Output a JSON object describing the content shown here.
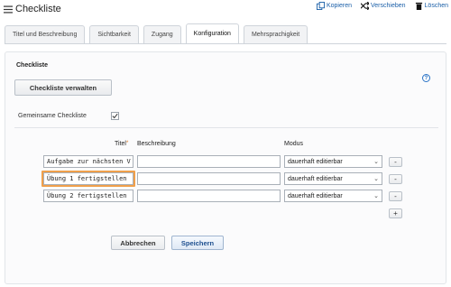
{
  "header": {
    "title": "Checkliste",
    "actions": [
      {
        "label": "Kopieren",
        "icon": "copy-icon"
      },
      {
        "label": "Verschieben",
        "icon": "move-icon"
      },
      {
        "label": "Löschen",
        "icon": "trash-icon"
      }
    ]
  },
  "tabs": [
    {
      "label": "Titel und Beschreibung",
      "active": false
    },
    {
      "label": "Sichtbarkeit",
      "active": false
    },
    {
      "label": "Zugang",
      "active": false
    },
    {
      "label": "Konfiguration",
      "active": true
    },
    {
      "label": "Mehrsprachigkeit",
      "active": false
    }
  ],
  "panel": {
    "section_title": "Checkliste",
    "manage_button": "Checkliste verwalten",
    "help_icon": "help-icon",
    "shared_label": "Gemeinsame Checkliste",
    "shared_checked": true,
    "columns": {
      "title": "Titel",
      "required_mark": "*",
      "description": "Beschreibung",
      "mode": "Modus"
    },
    "rows": [
      {
        "title": "Aufgabe zur nächsten V",
        "description": "",
        "mode": "dauerhaft editierbar",
        "remove": "-"
      },
      {
        "title": "Übung 1 fertigstellen",
        "description": "",
        "mode": "dauerhaft editierbar",
        "remove": "-"
      },
      {
        "title": "Übung 2 fertigstellen",
        "description": "",
        "mode": "dauerhaft editierbar",
        "remove": "-"
      }
    ],
    "add": "+",
    "cancel_button": "Abbrechen",
    "save_button": "Speichern"
  },
  "colors": {
    "link": "#1a5fa8",
    "highlight": "#f0a04b",
    "required": "#e07a1f"
  }
}
